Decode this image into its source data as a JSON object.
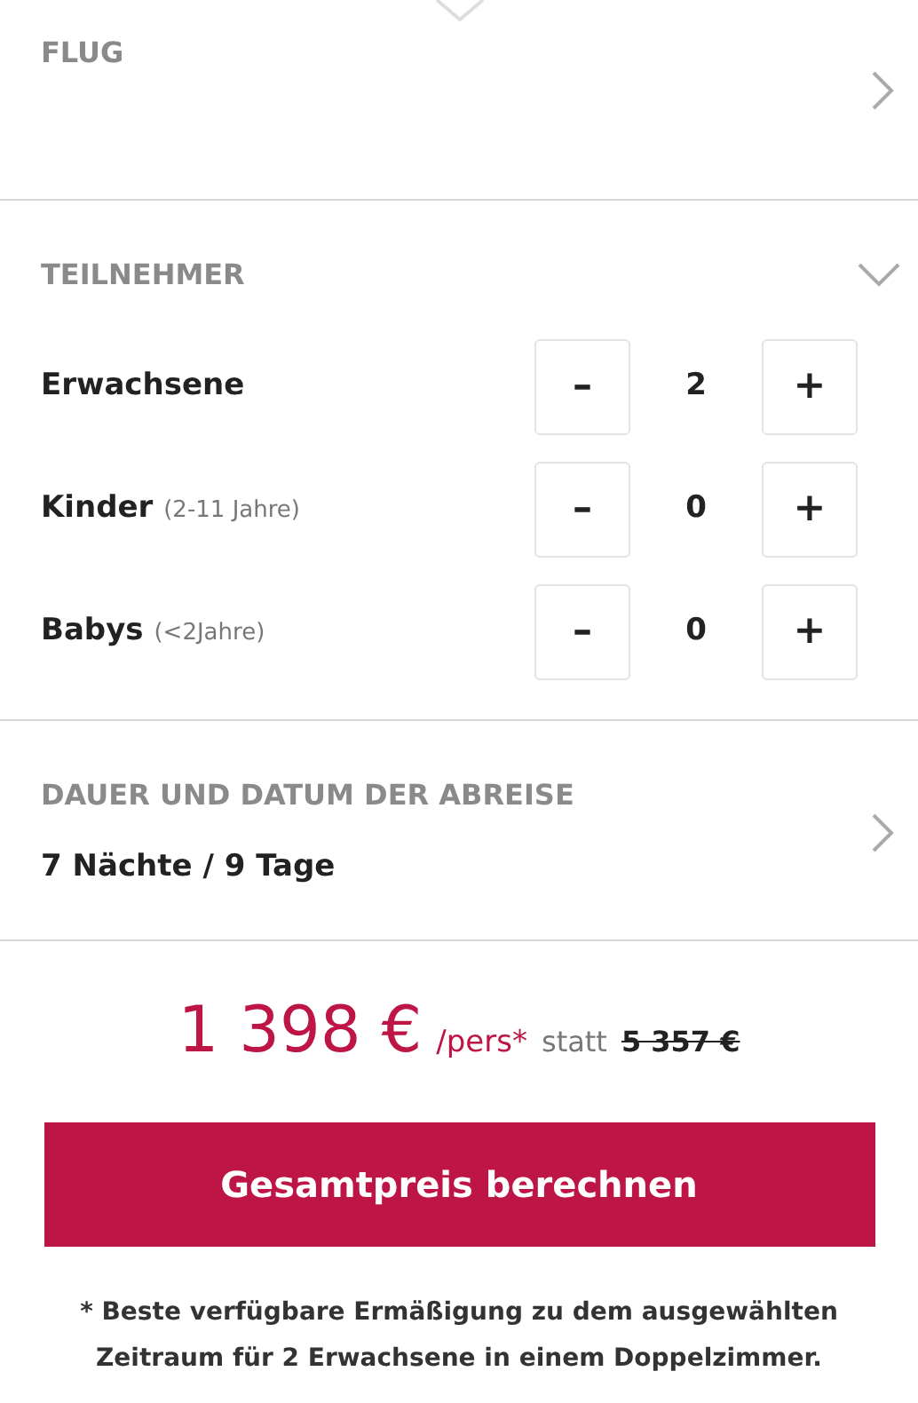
{
  "sections": [
    {
      "title": "FLUG",
      "expanded": false
    },
    {
      "title": "TEILNEHMER",
      "expanded": true,
      "counters": [
        {
          "label": "Erwachsene",
          "minus": "–",
          "value": "2",
          "plus": "+"
        },
        {
          "label": "Kinder",
          "hint": "(2-11 Jahre)",
          "minus": "–",
          "value": "0",
          "plus": "+"
        },
        {
          "label": "Babys",
          "hint": "(<2Jahre)",
          "minus": "–",
          "value": "0",
          "plus": "+"
        }
      ]
    },
    {
      "title": "DAUER UND DATUM DER ABREISE",
      "expanded": false,
      "value": "7 Nächte / 9 Tage"
    }
  ],
  "price": {
    "amount": "1 398 €",
    "unit": "/pers*",
    "statt": "statt",
    "old": "5 357 €"
  },
  "button": "Gesamtpreis berechnen",
  "note": "* Beste verfügbare Ermäßigung zu dem ausgewählten Zeitraum für 2 Erwachsene in einem Doppelzimmer."
}
